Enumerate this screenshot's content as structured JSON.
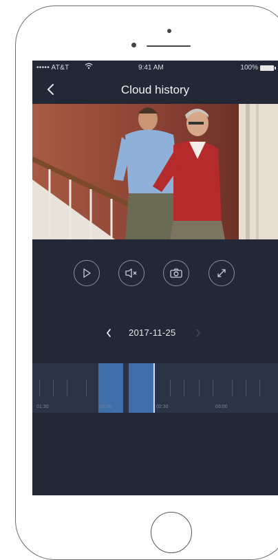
{
  "status_bar": {
    "carrier": "••••• AT&T",
    "time": "9:41 AM",
    "battery": "100%"
  },
  "nav": {
    "title": "Cloud history",
    "back_icon": "chevron-left-icon"
  },
  "video": {
    "description_icon": "video-frame"
  },
  "controls": [
    {
      "name": "play",
      "icon": "play-icon"
    },
    {
      "name": "mute",
      "icon": "speaker-mute-icon"
    },
    {
      "name": "snapshot",
      "icon": "camera-icon"
    },
    {
      "name": "fullscreen",
      "icon": "expand-icon"
    }
  ],
  "date": {
    "value": "2017-11-25",
    "prev_icon": "chevron-left-icon",
    "next_icon": "chevron-right-icon"
  },
  "timeline": {
    "labels": [
      "01:30",
      "02:00",
      "02:30",
      "03:00"
    ]
  },
  "colors": {
    "screen_bg": "#232836",
    "timeline_bg": "#2b3345",
    "recorded_segment": "#3f6ea8",
    "playhead": "#cfe0ff"
  }
}
